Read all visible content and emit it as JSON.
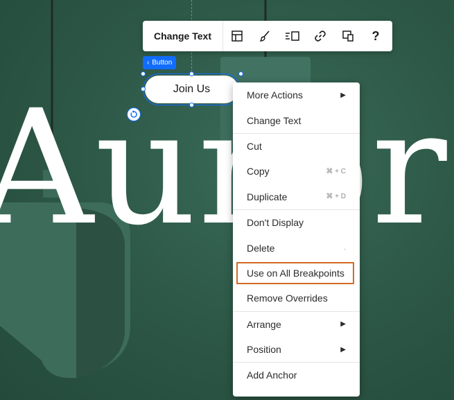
{
  "toolbar": {
    "change_text_label": "Change Text",
    "icons": [
      "layout-icon",
      "design-brush-icon",
      "stretch-icon",
      "link-icon",
      "responsive-icon",
      "help-icon"
    ],
    "help_glyph": "?"
  },
  "element_tag": {
    "chevron": "‹",
    "label": "Button"
  },
  "selected_button": {
    "label": "Join Us"
  },
  "hero": {
    "word": "Aurora"
  },
  "context_menu": {
    "groups": [
      [
        {
          "label": "More Actions",
          "submenu": true
        },
        {
          "label": "Change Text"
        }
      ],
      [
        {
          "label": "Cut"
        },
        {
          "label": "Copy",
          "shortcut": "⌘ + C"
        },
        {
          "label": "Duplicate",
          "shortcut": "⌘ + D"
        }
      ],
      [
        {
          "label": "Don't Display"
        },
        {
          "label": "Delete",
          "shortcut": "."
        },
        {
          "label": "Use on All Breakpoints",
          "highlighted": true
        },
        {
          "label": "Remove Overrides"
        }
      ],
      [
        {
          "label": "Arrange",
          "submenu": true
        },
        {
          "label": "Position",
          "submenu": true
        }
      ],
      [
        {
          "label": "Add Anchor"
        }
      ]
    ],
    "submenu_glyph": "▶"
  },
  "colors": {
    "selection_blue": "#116dff",
    "highlight_orange": "#d16a22",
    "background_green": "#2f5a4a"
  }
}
